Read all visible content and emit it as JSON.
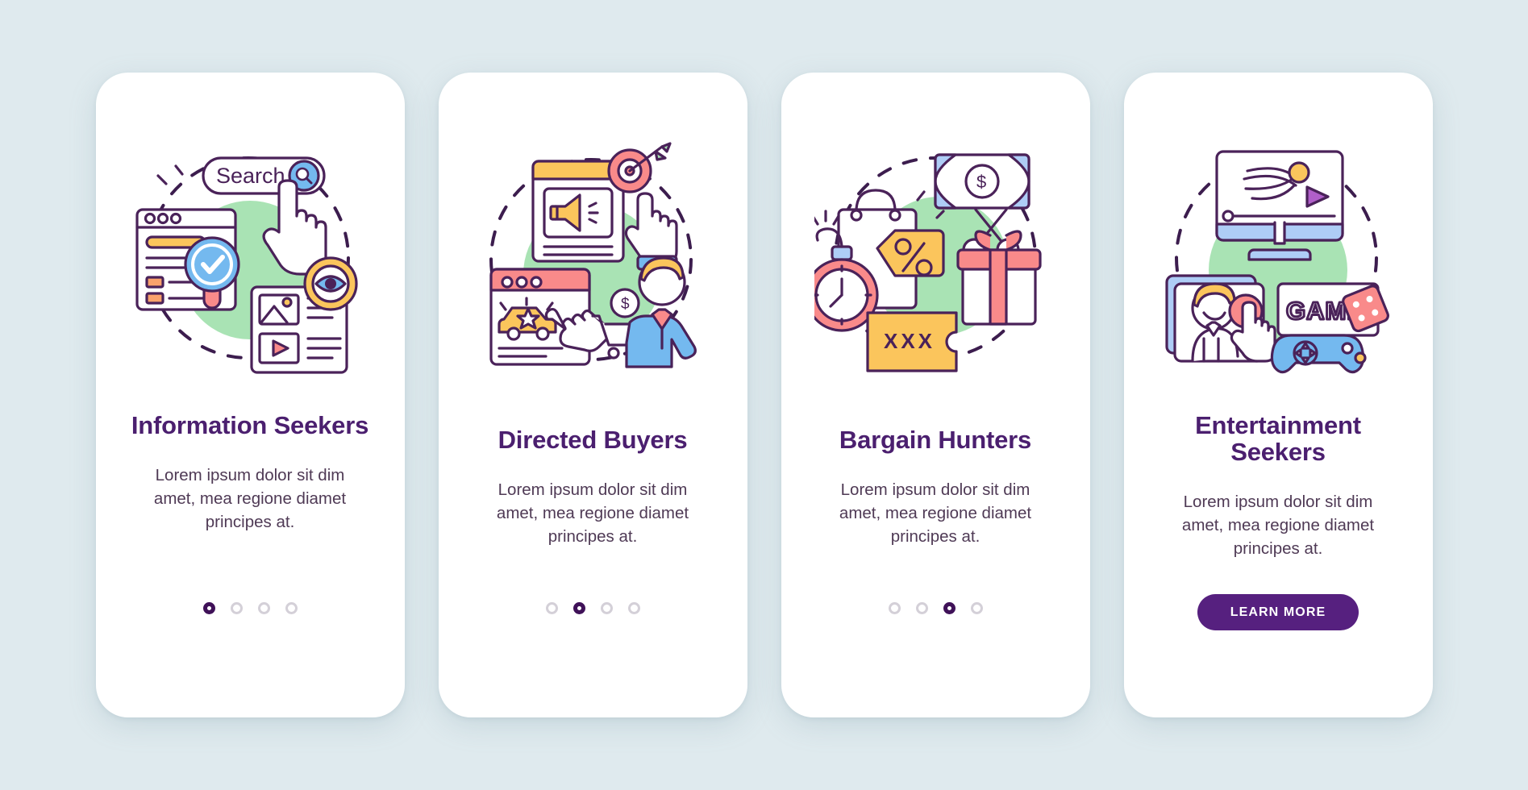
{
  "theme": {
    "background": "#dfeaee",
    "card_background": "#ffffff",
    "title_color": "#4b1f6f",
    "body_color": "#4f3a55",
    "accent_purple": "#56207f",
    "dot_active": "#3f1158",
    "dot_inactive": "#d4d0d8",
    "illustration_blob": "#a9e3b4",
    "stroke": "#4a2259",
    "yellow": "#fbc55c",
    "pink": "#f98a8a",
    "blue": "#74b9ef",
    "light_blue": "#aecdf6",
    "orange": "#f9a26c"
  },
  "cards": [
    {
      "id": "information-seekers",
      "title": "Information Seekers",
      "body": "Lorem ipsum dolor sit dim amet, mea regione diamet principes at.",
      "illustration": {
        "name": "information-seekers-illustration",
        "search_label": "Search",
        "icons": [
          "search-bar-icon",
          "browser-window-icon",
          "check-badge-icon",
          "pointer-hand-icon",
          "eye-icon",
          "video-player-icon",
          "dashed-circle"
        ]
      },
      "pagination": {
        "total": 4,
        "active_index": 0
      },
      "button": null
    },
    {
      "id": "directed-buyers",
      "title": "Directed Buyers",
      "body": "Lorem ipsum dolor sit dim amet, mea regione diamet principes at.",
      "illustration": {
        "name": "directed-buyers-illustration",
        "search_label": "",
        "icons": [
          "megaphone-card-icon",
          "target-icon",
          "pointer-hand-icon",
          "browser-window-icon",
          "car-star-icon",
          "shopping-cart-icon",
          "businessman-icon",
          "dashed-circle"
        ]
      },
      "pagination": {
        "total": 4,
        "active_index": 1
      },
      "button": null
    },
    {
      "id": "bargain-hunters",
      "title": "Bargain Hunters",
      "body": "Lorem ipsum dolor sit dim amet, mea regione diamet principes at.",
      "illustration": {
        "name": "bargain-hunters-illustration",
        "coupon_label": "XXX",
        "icons": [
          "alarm-timer-icon",
          "shopping-bag-icon",
          "percent-tag-icon",
          "banknote-dollar-icon",
          "scissors-icon",
          "gift-box-icon",
          "coupon-ticket-icon",
          "dashed-circle"
        ]
      },
      "pagination": {
        "total": 4,
        "active_index": 2
      },
      "button": null
    },
    {
      "id": "entertainment-seekers",
      "title": "Entertainment Seekers",
      "body": "Lorem ipsum dolor sit dim amet, mea regione diamet principes at.",
      "illustration": {
        "name": "entertainment-seekers-illustration",
        "game_label": "GAME",
        "icons": [
          "monitor-video-icon",
          "person-laptop-icon",
          "pointer-hand-icon",
          "game-sign-icon",
          "gamepad-icon",
          "dice-icon",
          "dashed-circle"
        ]
      },
      "pagination": {
        "total": 4,
        "active_index": 3
      },
      "button": {
        "label": "LEARN MORE",
        "name": "learn-more-button"
      }
    }
  ]
}
